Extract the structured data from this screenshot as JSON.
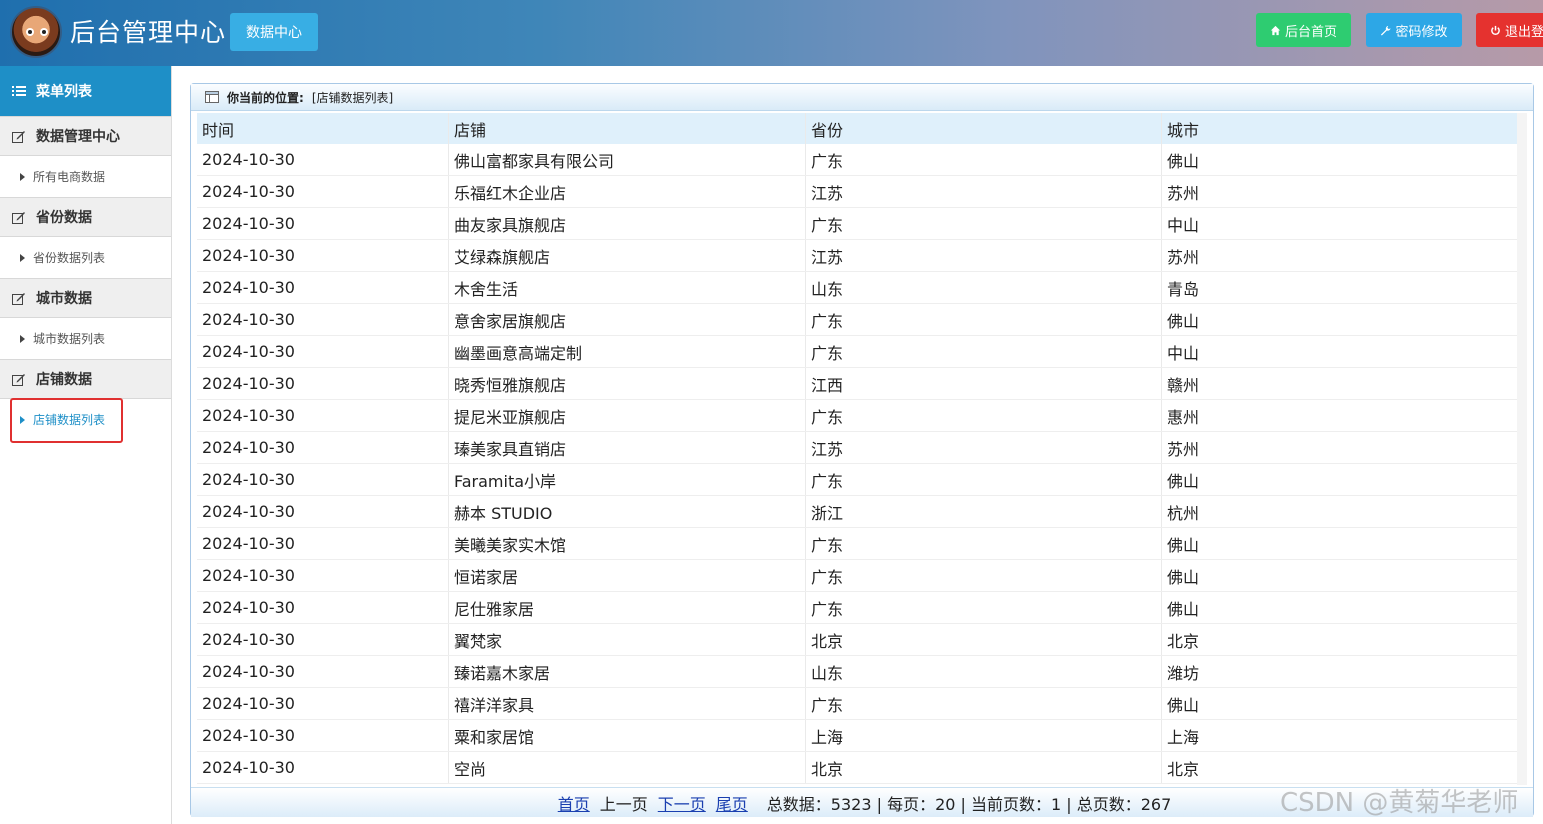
{
  "header": {
    "app_title": "后台管理中心",
    "data_center_button": "数据中心",
    "home_button": "后台首页",
    "password_button": "密码修改",
    "logout_button": "退出登"
  },
  "sidebar": {
    "title": "菜单列表",
    "groups": [
      {
        "label": "数据管理中心",
        "items": [
          {
            "label": "所有电商数据"
          }
        ]
      },
      {
        "label": "省份数据",
        "items": [
          {
            "label": "省份数据列表"
          }
        ]
      },
      {
        "label": "城市数据",
        "items": [
          {
            "label": "城市数据列表"
          }
        ]
      },
      {
        "label": "店铺数据",
        "items": [
          {
            "label": "店铺数据列表"
          }
        ]
      }
    ]
  },
  "breadcrumb": {
    "prefix": "你当前的位置:",
    "path": "[店铺数据列表]"
  },
  "table": {
    "columns": [
      "时间",
      "店铺",
      "省份",
      "城市"
    ],
    "rows": [
      [
        "2024-10-30",
        "佛山富都家具有限公司",
        "广东",
        "佛山"
      ],
      [
        "2024-10-30",
        "乐福红木企业店",
        "江苏",
        "苏州"
      ],
      [
        "2024-10-30",
        "曲友家具旗舰店",
        "广东",
        "中山"
      ],
      [
        "2024-10-30",
        "艾绿森旗舰店",
        "江苏",
        "苏州"
      ],
      [
        "2024-10-30",
        "木舍生活",
        "山东",
        "青岛"
      ],
      [
        "2024-10-30",
        "意舍家居旗舰店",
        "广东",
        "佛山"
      ],
      [
        "2024-10-30",
        "幽墨画意高端定制",
        "广东",
        "中山"
      ],
      [
        "2024-10-30",
        "晓秀恒雅旗舰店",
        "江西",
        "赣州"
      ],
      [
        "2024-10-30",
        "提尼米亚旗舰店",
        "广东",
        "惠州"
      ],
      [
        "2024-10-30",
        "瑧美家具直销店",
        "江苏",
        "苏州"
      ],
      [
        "2024-10-30",
        "Faramita小岸",
        "广东",
        "佛山"
      ],
      [
        "2024-10-30",
        "赫本 STUDIO",
        "浙江",
        "杭州"
      ],
      [
        "2024-10-30",
        "美曦美家实木馆",
        "广东",
        "佛山"
      ],
      [
        "2024-10-30",
        "恒诺家居",
        "广东",
        "佛山"
      ],
      [
        "2024-10-30",
        "尼仕雅家居",
        "广东",
        "佛山"
      ],
      [
        "2024-10-30",
        "翼梵家",
        "北京",
        "北京"
      ],
      [
        "2024-10-30",
        "臻诺嘉木家居",
        "山东",
        "潍坊"
      ],
      [
        "2024-10-30",
        "禧洋洋家具",
        "广东",
        "佛山"
      ],
      [
        "2024-10-30",
        "粟和家居馆",
        "上海",
        "上海"
      ],
      [
        "2024-10-30",
        "空尚",
        "北京",
        "北京"
      ]
    ]
  },
  "pager": {
    "first": "首页",
    "prev": "上一页",
    "next": "下一页",
    "last": "尾页",
    "stats": "总数据：5323 | 每页：20 | 当前页数：1 | 总页数：267"
  },
  "watermark": "CSDN @黄菊华老师",
  "colors": {
    "accent": "#1e8fc7",
    "home_button": "#2ecc71",
    "password_button": "#2da7e6",
    "logout_button": "#e5322f",
    "highlight": "#e03030"
  }
}
